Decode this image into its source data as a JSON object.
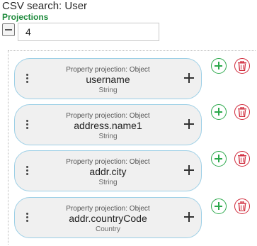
{
  "window": {
    "title": "CSV search: User"
  },
  "section": {
    "label": "Projections"
  },
  "count_input": {
    "value": "4"
  },
  "projections": [
    {
      "caption": "Property projection: Object",
      "name": "username",
      "type": "String"
    },
    {
      "caption": "Property projection: Object",
      "name": "address.name1",
      "type": "String"
    },
    {
      "caption": "Property projection: Object",
      "name": "addr.city",
      "type": "String"
    },
    {
      "caption": "Property projection: Object",
      "name": "addr.countryCode",
      "type": "Country"
    }
  ],
  "colors": {
    "section_label": "#1e8a3c",
    "card_border": "#9ccfe6",
    "card_bg": "#f0f0f0",
    "add": "#2aa84a",
    "delete": "#d0293a"
  },
  "icons": {
    "collapse": "minus-square-icon",
    "drag": "kebab-icon",
    "expand": "plus-icon",
    "add": "plus-circle-icon",
    "delete": "trash-circle-icon"
  }
}
